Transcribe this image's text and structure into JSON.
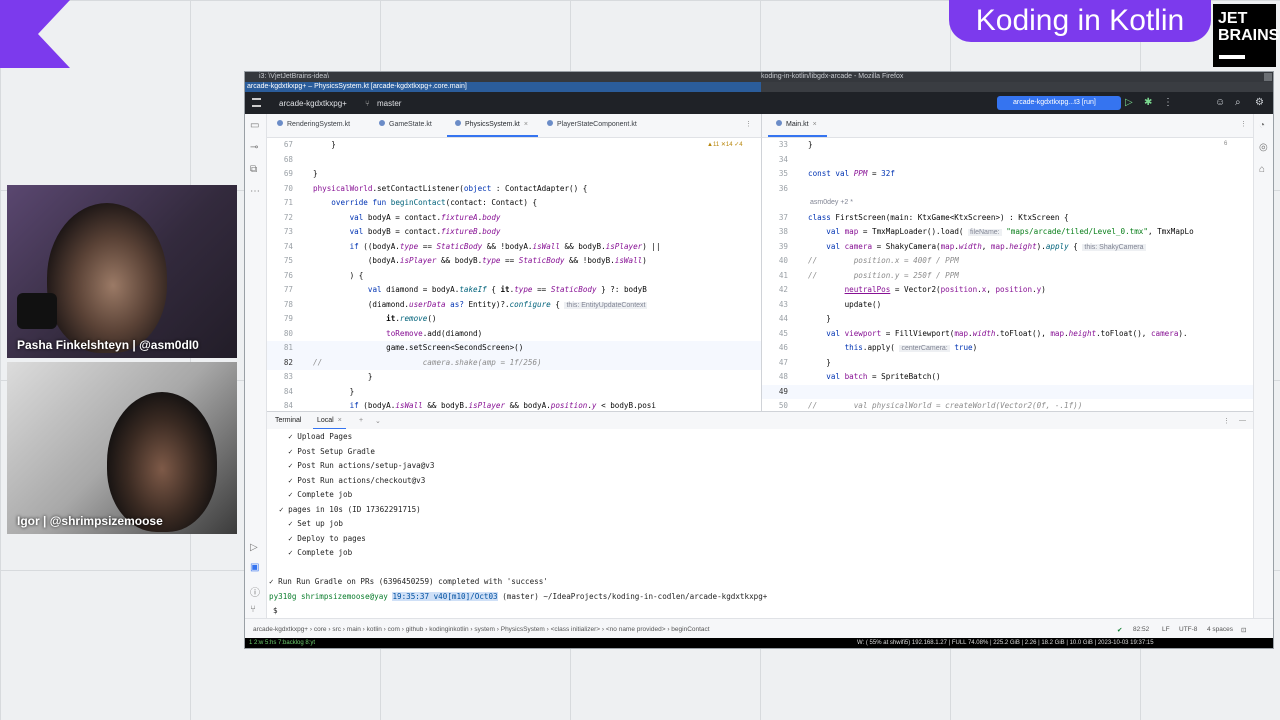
{
  "overlay": {
    "show_title": "Koding in Kotlin",
    "logo_line1": "JET",
    "logo_line2": "BRAINS",
    "cam1_name": "Pasha Finkelshteyn | @asm0dI0",
    "cam2_name": "Igor | @shrimpsizemoose"
  },
  "window": {
    "os_title": "i3: \\VjetJetBrains-idea\\",
    "os_title_right": "koding-in-kotlin/libgdx-arcade - Mozilla Firefox",
    "file_title": "arcade-kgdxtkxpg+ – PhysicsSystem.kt [arcade-kgdxtkxpg+.core.main]"
  },
  "toolbar": {
    "project": "arcade-kgdxtkxpg+",
    "branch": "master",
    "run_config": "arcade-kgdxtkxpg...t3 [run]"
  },
  "left_tabs": [
    "RenderingSystem.kt",
    "GameState.kt",
    "PhysicsSystem.kt",
    "PlayerStateComponent.kt"
  ],
  "right_tabs": [
    "Main.kt"
  ],
  "left_indicators": "▲11 ✕14 ✓4",
  "right_indicators": "6",
  "left_editor": {
    "numbers": [
      "67",
      "68",
      "69",
      "70",
      "71",
      "72",
      "73",
      "74",
      "75",
      "76",
      "77",
      "78",
      "79",
      "80",
      "81",
      "82",
      "83",
      "84"
    ],
    "lines": [
      "            }",
      "",
      "        }",
      "        physicalWorld.setContactListener(object : ContactAdapter() {",
      "            override fun beginContact(contact: Contact) {",
      "                val bodyA = contact.fixtureA.body",
      "                val bodyB = contact.fixtureB.body",
      "                if ((bodyA.type == StaticBody && !bodyA.isWall && bodyB.isPlayer) ||",
      "                    (bodyA.isPlayer && bodyB.type == StaticBody && !bodyB.isWall)",
      "                ) {",
      "                    val diamond = bodyA.takeIf { it.type == StaticBody } ?: bodyB",
      "                    (diamond.userData as? Entity)?.configure {",
      "                        it.remove()",
      "                        toRemove.add(diamond)",
      "                        game.setScreen<SecondScreen>()",
      "//                      camera.shake(amp = 1f/256)",
      "                    }",
      "                }",
      "                if (bodyA.isWall && bodyB.isPlayer && bodyA.position.y < bodyB.posi"
    ],
    "hint_configure": "this: EntityUpdateContext"
  },
  "right_editor": {
    "numbers": [
      "33",
      "34",
      "35",
      "36",
      "",
      "37",
      "38",
      "39",
      "40",
      "41",
      "42",
      "43",
      "44",
      "45",
      "46",
      "47",
      "48",
      "49",
      "50"
    ],
    "lines": [
      "}",
      "",
      "const val PPM = 32f",
      "",
      "asm0dey +2 *",
      "class FirstScreen(main: KtxGame<KtxScreen>) : KtxScreen {",
      "    val map = TmxMapLoader().load( \"maps/arcade/tiled/Level_0.tmx\", TmxMapLo",
      "    val camera = ShakyCamera(map.width, map.height).apply {",
      "//        position.x = 400f / PPM",
      "//        position.y = 250f / PPM",
      "        neutralPos = Vector2(position.x, position.y)",
      "        update()",
      "    }",
      "    val viewport = FillViewport(map.width.toFloat(), map.height.toFloat(), camera).",
      "        this.apply( true)",
      "    }",
      "    val batch = SpriteBatch()",
      "",
      "//        val physicalWorld = createWorld(Vector2(0f, -.1f))"
    ],
    "hint_filename": "fileName:",
    "hint_this": "this: ShakyCamera",
    "hint_center": "centerCamera:"
  },
  "terminal": {
    "tab_label": "Terminal",
    "local_tab": "Local",
    "lines": [
      "  ✓ Upload Pages",
      "  ✓ Post Setup Gradle",
      "  ✓ Post Run actions/setup-java@v3",
      "  ✓ Post Run actions/checkout@v3",
      "  ✓ Complete job",
      "✓ pages in 10s (ID 17362291715)",
      "  ✓ Set up job",
      "  ✓ Deploy to pages",
      "  ✓ Complete job",
      "",
      "✓ Run Run Gradle on PRs (6396450259) completed with 'success'"
    ],
    "prompt_user": "py310g shrimpsizemoose@yay",
    "prompt_time": "19:35:37 v40[m10]/Oct03",
    "prompt_rest": "(master) ~/IdeaProjects/koding-in-codlen/arcade-kgdxtkxpg+",
    "cursor_line": "$"
  },
  "statusbar": {
    "breadcrumb": [
      "arcade-kgdxtkxpg+",
      "core",
      "src",
      "main",
      "kotlin",
      "com",
      "github",
      "kodinginkotlin",
      "system",
      "PhysicsSystem",
      "<class initializer>",
      "<no name provided>",
      "beginContact"
    ],
    "position": "82:52",
    "line_sep": "LF",
    "encoding": "UTF-8",
    "indent": "4 spaces"
  },
  "tmux": {
    "left": "1 2:w  5:hs  7:backlog  8:yt",
    "right": "W: ( 55% at shwifi5) 192.168.1.27 | FULL 74.08% | 225.2 GiB | 2.26 | 18.2 GiB | 10.0 GiB | 2023-10-03 19:37:15"
  }
}
